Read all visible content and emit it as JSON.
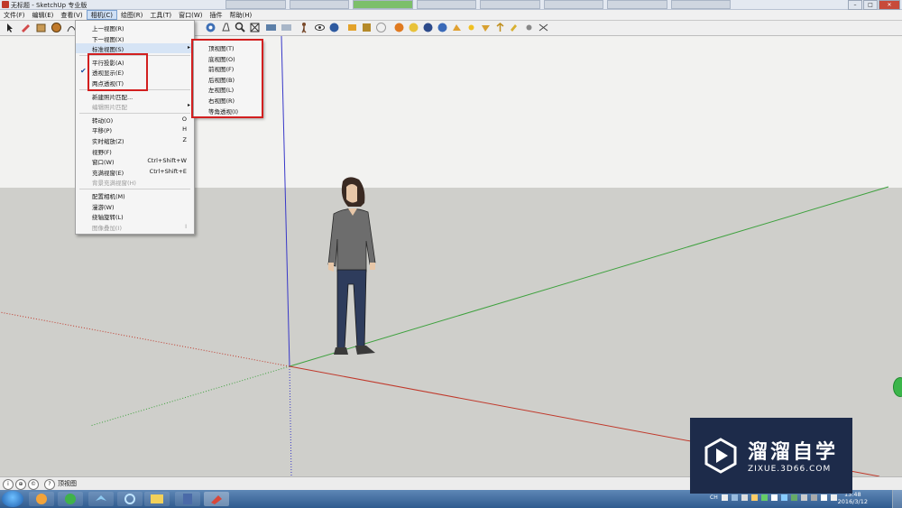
{
  "window": {
    "title": "无标题 - SketchUp 专业版"
  },
  "menubar": {
    "items": [
      {
        "label": "文件(F)"
      },
      {
        "label": "编辑(E)"
      },
      {
        "label": "查看(V)"
      },
      {
        "label": "相机(C)"
      },
      {
        "label": "绘图(R)"
      },
      {
        "label": "工具(T)"
      },
      {
        "label": "窗口(W)"
      },
      {
        "label": "插件"
      },
      {
        "label": "帮助(H)"
      }
    ],
    "active_index": 3
  },
  "camera_menu": {
    "items": [
      {
        "label": "上一视图(R)",
        "shortcut": "",
        "disabled": false
      },
      {
        "label": "下一视图(X)",
        "shortcut": "",
        "disabled": false
      },
      {
        "label": "标准视图(S)",
        "shortcut": "",
        "disabled": false,
        "submenu": true,
        "highlighted": true
      },
      {
        "sep": true
      },
      {
        "label": "平行投影(A)",
        "shortcut": "",
        "disabled": false
      },
      {
        "label": "透视显示(E)",
        "shortcut": "",
        "disabled": false,
        "checked": true
      },
      {
        "label": "两点透视(T)",
        "shortcut": "",
        "disabled": false
      },
      {
        "sep": true
      },
      {
        "label": "新建照片匹配...",
        "shortcut": "",
        "disabled": false
      },
      {
        "label": "编辑照片匹配",
        "shortcut": "",
        "disabled": true,
        "submenu": true
      },
      {
        "sep": true
      },
      {
        "label": "转动(O)",
        "shortcut": "O",
        "disabled": false
      },
      {
        "label": "平移(P)",
        "shortcut": "H",
        "disabled": false
      },
      {
        "label": "实时缩放(Z)",
        "shortcut": "Z",
        "disabled": false
      },
      {
        "label": "视野(F)",
        "shortcut": "",
        "disabled": false
      },
      {
        "label": "窗口(W)",
        "shortcut": "Ctrl+Shift+W",
        "disabled": false
      },
      {
        "label": "充满视窗(E)",
        "shortcut": "Ctrl+Shift+E",
        "disabled": false
      },
      {
        "label": "背景充满视窗(H)",
        "shortcut": "",
        "disabled": true
      },
      {
        "sep": true
      },
      {
        "label": "配置相机(M)",
        "shortcut": "",
        "disabled": false
      },
      {
        "label": "漫游(W)",
        "shortcut": "",
        "disabled": false
      },
      {
        "label": "绕轴旋转(L)",
        "shortcut": "",
        "disabled": false
      },
      {
        "label": "图像叠加(I)",
        "shortcut": "I",
        "disabled": true
      }
    ]
  },
  "standard_views": {
    "items": [
      {
        "label": "顶视图(T)"
      },
      {
        "label": "底视图(O)"
      },
      {
        "label": "前视图(F)"
      },
      {
        "label": "后视图(B)"
      },
      {
        "label": "左视图(L)"
      },
      {
        "label": "右视图(R)"
      },
      {
        "label": "等角透视(I)"
      }
    ]
  },
  "statusbar": {
    "text": "顶视图",
    "icons": [
      "info-icon",
      "geo-icon",
      "credit-icon",
      "help-icon"
    ]
  },
  "taskbar": {
    "clock_time": "13:48",
    "clock_date": "2016/3/12",
    "lang": "CH"
  },
  "watermark": {
    "brand": "溜溜自学",
    "url": "ZIXUE.3D66.COM"
  },
  "colors": {
    "axis_red": "#c0392b",
    "axis_green": "#3ea13e",
    "axis_blue": "#3838c8",
    "highlight_box": "#d21f1f",
    "sky": "#f2f2f0",
    "ground": "#cfcfcb"
  }
}
